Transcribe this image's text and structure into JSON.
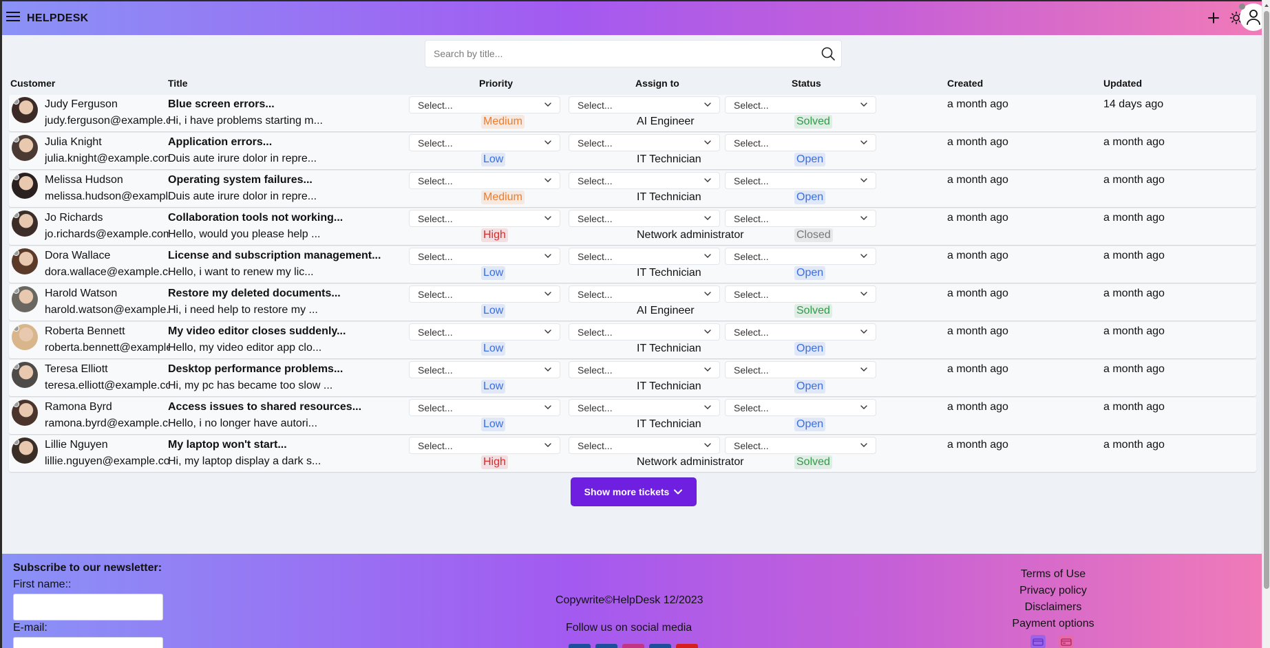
{
  "header": {
    "brand": "HELPDESK"
  },
  "search": {
    "placeholder": "Search by title..."
  },
  "columns": {
    "customer": "Customer",
    "title": "Title",
    "priority": "Priority",
    "assign_to": "Assign to",
    "status": "Status",
    "created": "Created",
    "updated": "Updated"
  },
  "select_placeholder": "Select...",
  "priority_colors": {
    "Medium": "#f07a26",
    "Low": "#3a6fe0",
    "High": "#d92b2b"
  },
  "status_colors": {
    "Solved": "#2f9a47",
    "Open": "#3a6fe0",
    "Closed": "#777777"
  },
  "tickets": [
    {
      "name": "Judy Ferguson",
      "email": "judy.ferguson@example.com",
      "title": "Blue screen errors...",
      "desc": "Hi, i have problems starting m...",
      "priority": "Medium",
      "assignee": "AI Engineer",
      "status": "Solved",
      "created": "a month ago",
      "updated": "14 days ago"
    },
    {
      "name": "Julia Knight",
      "email": "julia.knight@example.com",
      "title": "Application errors...",
      "desc": "Duis aute irure dolor in repre...",
      "priority": "Low",
      "assignee": "IT Technician",
      "status": "Open",
      "created": "a month ago",
      "updated": "a month ago"
    },
    {
      "name": "Melissa Hudson",
      "email": "melissa.hudson@example.com",
      "title": "Operating system failures...",
      "desc": "Duis aute irure dolor in repre...",
      "priority": "Medium",
      "assignee": "IT Technician",
      "status": "Open",
      "created": "a month ago",
      "updated": "a month ago"
    },
    {
      "name": "Jo Richards",
      "email": "jo.richards@example.com",
      "title": "Collaboration tools not working...",
      "desc": "Hello, would you please help ...",
      "priority": "High",
      "assignee": "Network administrator",
      "status": "Closed",
      "created": "a month ago",
      "updated": "a month ago"
    },
    {
      "name": "Dora Wallace",
      "email": "dora.wallace@example.com",
      "title": "License and subscription management...",
      "desc": "Hello, i want to renew my lic...",
      "priority": "Low",
      "assignee": "IT Technician",
      "status": "Open",
      "created": "a month ago",
      "updated": "a month ago"
    },
    {
      "name": "Harold Watson",
      "email": "harold.watson@example.com",
      "title": "Restore my deleted documents...",
      "desc": "Hi, i need help to restore my ...",
      "priority": "Low",
      "assignee": "AI Engineer",
      "status": "Solved",
      "created": "a month ago",
      "updated": "a month ago"
    },
    {
      "name": "Roberta Bennett",
      "email": "roberta.bennett@example.com",
      "title": "My video editor closes suddenly...",
      "desc": "Hello, my video editor app clo...",
      "priority": "Low",
      "assignee": "IT Technician",
      "status": "Open",
      "created": "a month ago",
      "updated": "a month ago"
    },
    {
      "name": "Teresa Elliott",
      "email": "teresa.elliott@example.com",
      "title": "Desktop performance problems...",
      "desc": "Hi, my pc has became too slow ...",
      "priority": "Low",
      "assignee": "IT Technician",
      "status": "Open",
      "created": "a month ago",
      "updated": "a month ago"
    },
    {
      "name": "Ramona Byrd",
      "email": "ramona.byrd@example.com",
      "title": "Access issues to shared resources...",
      "desc": "Hello, i no longer have autori...",
      "priority": "Low",
      "assignee": "IT Technician",
      "status": "Open",
      "created": "a month ago",
      "updated": "a month ago"
    },
    {
      "name": "Lillie Nguyen",
      "email": "lillie.nguyen@example.com",
      "title": "My laptop won't start...",
      "desc": "Hi, my laptop display a dark s...",
      "priority": "High",
      "assignee": "Network administrator",
      "status": "Solved",
      "created": "a month ago",
      "updated": "a month ago"
    }
  ],
  "show_more": "Show more tickets",
  "footer": {
    "newsletter_title": "Subscribe to our newsletter:",
    "first_name_label": "First name::",
    "email_label": "E-mail:",
    "copyright": "Copywrite©HelpDesk 12/2023",
    "follow": "Follow us on social media",
    "links": [
      "Terms of Use",
      "Privacy policy",
      "Disclaimers",
      "Payment options"
    ],
    "social_icons": [
      "linkedin-icon",
      "facebook-icon",
      "instagram-icon",
      "linkedin-alt-icon",
      "youtube-icon"
    ],
    "social_colors": [
      "#1d4e9c",
      "#1d4e9c",
      "#c13584",
      "#1d4e9c",
      "#d62020"
    ]
  }
}
